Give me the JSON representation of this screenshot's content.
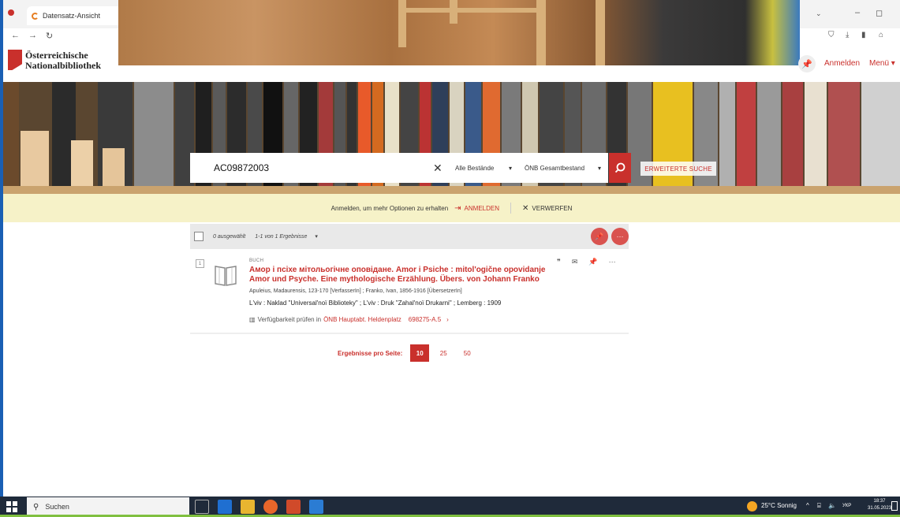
{
  "browser": {
    "tab_title": "Datensatz-Ansicht",
    "window_min": "–",
    "window_max": "◻"
  },
  "header": {
    "logo_line1": "Österreichische",
    "logo_line2": "Nationalbibliothek",
    "login_label": "Anmelden",
    "menu_label": "Menü"
  },
  "search": {
    "value": "AC09872003",
    "scope1": "Alle Bestände",
    "scope2": "ÖNB Gesamtbestand",
    "advanced_label": "ERWEITERTE SUCHE"
  },
  "notice": {
    "text": "Anmelden, um mehr Optionen zu erhalten",
    "login_label": "ANMELDEN",
    "dismiss_label": "VERWERFEN"
  },
  "results_bar": {
    "selected_text": "0 ausgewählt",
    "count_text": "1-1 von 1 Ergebnisse"
  },
  "result": {
    "number": "1",
    "type": "BUCH",
    "title": "Амор і псіхе мітольогічне оповідане. Amor i Psiche : mitol'ogične opovidanje Amor und Psyche. Eine mythologische Erzählung. Übers. von Johann Franko",
    "authors": "Apuleius, Madaurensis, 123-170 [VerfasserIn] ; Franko, Ivan, 1856-1916 [ÜbersetzerIn]",
    "publication": "L'viv : Naklad \"Universal'noï Biblioteky\" ; L'viv : Druk \"Zahal'noï Drukarni\" ; Lemberg : 1909",
    "availability_prefix": "Verfügbarkeit prüfen in",
    "availability_location": "ÖNB Hauptabt. Heldenplatz",
    "availability_shelf": "698275-A.5"
  },
  "pager": {
    "label": "Ergebnisse pro Seite:",
    "opt1": "10",
    "opt2": "25",
    "opt3": "50"
  },
  "taskbar": {
    "search_placeholder": "Suchen",
    "weather": "25°C Sonnig",
    "lang": "УКР",
    "time": "18:37",
    "date": "31.05.2023"
  },
  "colors": {
    "accent": "#c9302c",
    "notice_bg": "#f6f2c8",
    "taskbar_bg": "#1f2a3a"
  }
}
